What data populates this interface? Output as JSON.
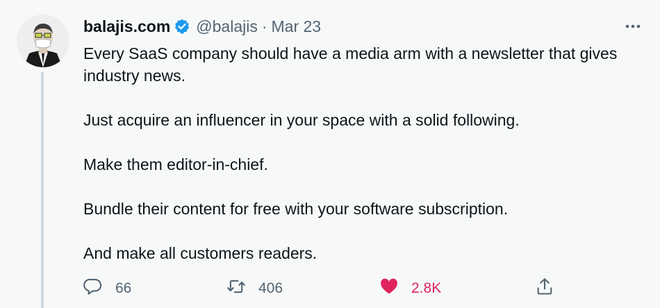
{
  "tweet": {
    "display_name": "balajis.com",
    "handle": "@balajis",
    "separator": "·",
    "date": "Mar 23",
    "verified_icon": "verified-badge-icon",
    "more_icon": "more-options-icon",
    "paragraphs": [
      "Every SaaS company should have a media arm with a newsletter that gives industry news.",
      "Just acquire an influencer in your space with a solid following.",
      "Make them editor-in-chief.",
      "Bundle their content for free with your software subscription.",
      "And make all customers readers."
    ],
    "actions": {
      "reply": {
        "icon": "reply-icon",
        "count": "66"
      },
      "retweet": {
        "icon": "retweet-icon",
        "count": "406"
      },
      "like": {
        "icon": "heart-icon",
        "count": "2.8K",
        "liked": true
      },
      "share": {
        "icon": "share-icon"
      }
    },
    "colors": {
      "background": "#f7f9f9",
      "text": "#0f1419",
      "secondary": "#536471",
      "verified": "#1d9bf0",
      "like": "#e0245e"
    }
  }
}
